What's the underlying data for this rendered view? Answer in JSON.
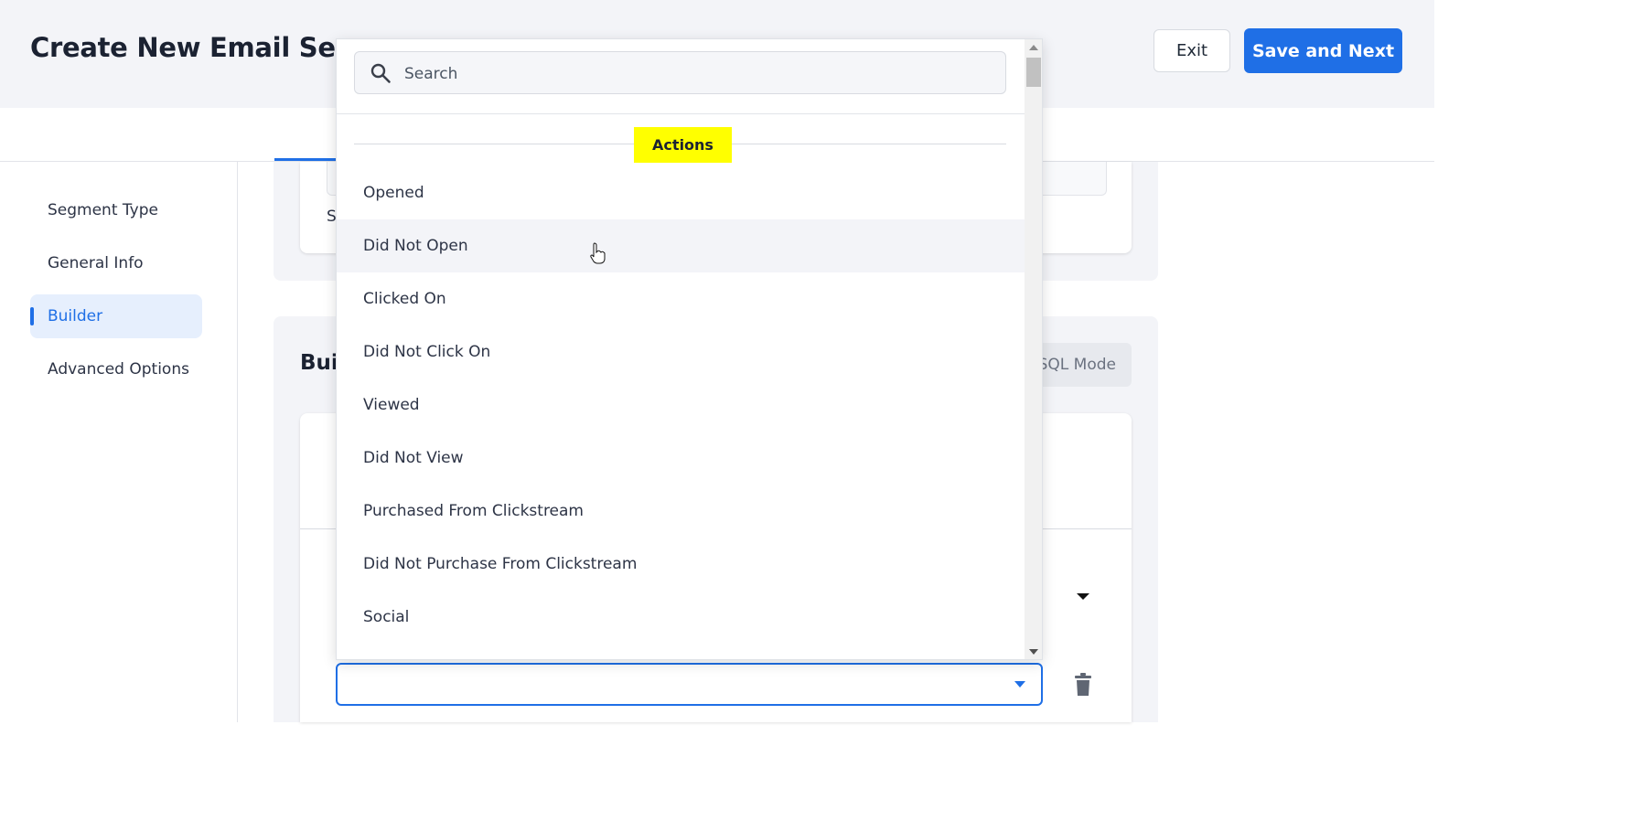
{
  "header": {
    "title": "Create New Email Segm",
    "exit_label": "Exit",
    "save_label": "Save and Next"
  },
  "sidebar": {
    "items": [
      {
        "label": "Segment Type"
      },
      {
        "label": "General Info"
      },
      {
        "label": "Builder",
        "active": true
      },
      {
        "label": "Advanced Options"
      }
    ]
  },
  "main": {
    "partial_text": "S",
    "builder_title": "Bui",
    "sql_mode_label": "SQL Mode"
  },
  "dropdown": {
    "search_placeholder": "Search",
    "group_label": "Actions",
    "items": [
      "Opened",
      "Did Not Open",
      "Clicked On",
      "Did Not Click On",
      "Viewed",
      "Did Not View",
      "Purchased From Clickstream",
      "Did Not Purchase From Clickstream",
      "Social"
    ],
    "hovered_item": "Did Not Open"
  },
  "colors": {
    "accent": "#1f6fe6",
    "highlight": "#ffff00",
    "header_bg": "#f3f4f8"
  },
  "icons": [
    "search-icon",
    "trash-icon",
    "chevron-down-icon",
    "pointer-cursor-icon"
  ]
}
